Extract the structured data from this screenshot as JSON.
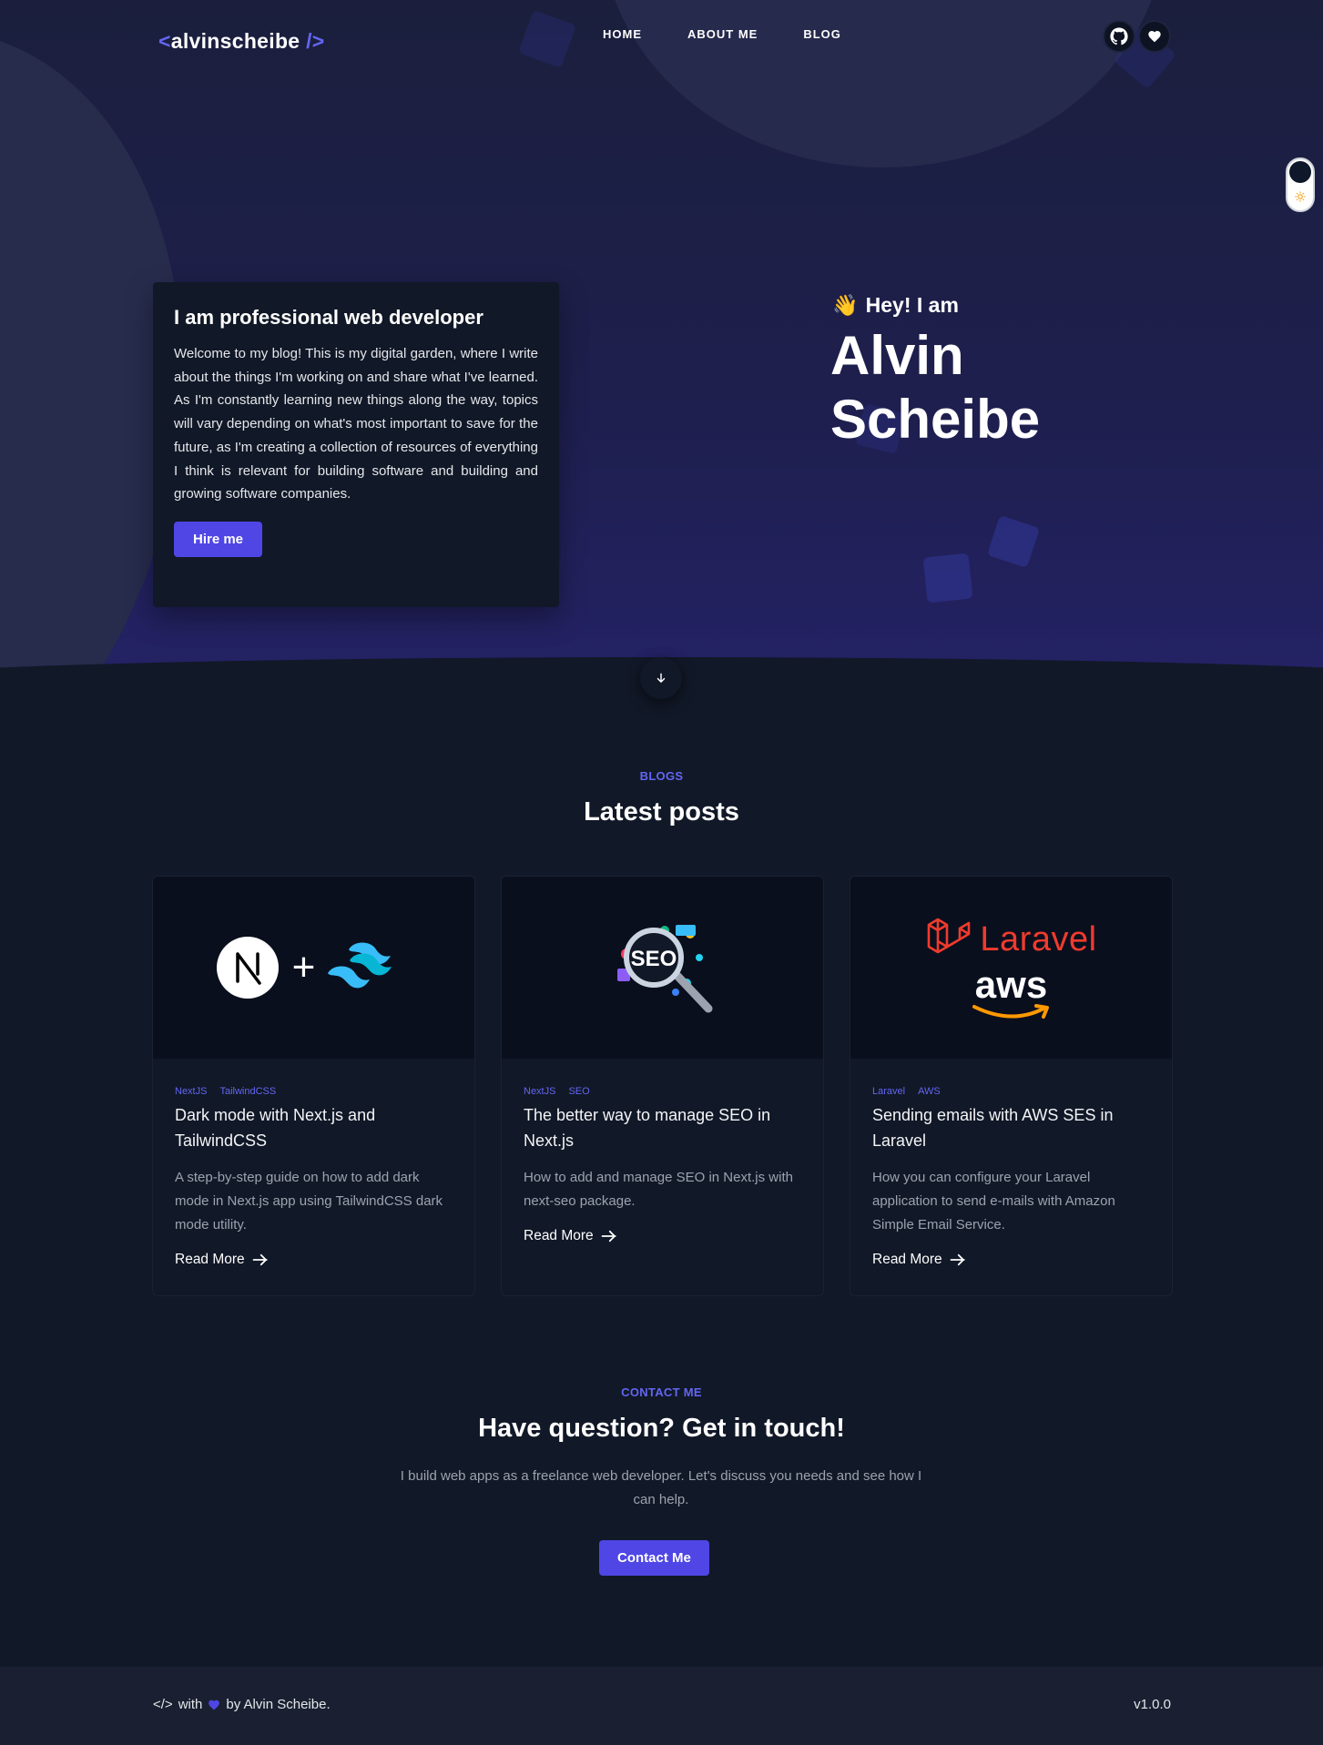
{
  "header": {
    "logo_open": "<",
    "logo_name": "alvinscheibe",
    "logo_close": "/>",
    "nav": [
      {
        "label": "HOME"
      },
      {
        "label": "ABOUT ME"
      },
      {
        "label": "BLOG"
      }
    ],
    "icons": [
      "github-icon",
      "heart-icon"
    ],
    "theme_toggle": {
      "state": "dark"
    }
  },
  "hero": {
    "card_title": "I am professional web developer",
    "card_text": "Welcome to my blog! This is my digital garden, where I write about the things I'm working on and share what I've learned. As I'm constantly learning new things along the way, topics will vary depending on what's most important to save for the future, as I'm creating a collection of resources of everything I think is relevant for building software and building and growing software companies.",
    "hire_label": "Hire me",
    "greeting": "Hey! I am",
    "greeting_emoji": "👋",
    "name_first": "Alvin",
    "name_last": "Scheibe"
  },
  "blogs": {
    "eyebrow": "BLOGS",
    "title": "Latest posts",
    "posts": [
      {
        "tags": [
          "NextJS",
          "TailwindCSS"
        ],
        "title": "Dark mode with Next.js and TailwindCSS",
        "description": "A step-by-step guide on how to add dark mode in Next.js app using TailwindCSS dark mode utility.",
        "read_more": "Read More",
        "thumb": "nextjs-tailwind-logo",
        "thumb_plus": "+"
      },
      {
        "tags": [
          "NextJS",
          "SEO"
        ],
        "title": "The better way to manage SEO in Next.js",
        "description": "How to add and manage SEO in Next.js with next-seo package.",
        "read_more": "Read More",
        "thumb": "seo-magnifier-logo",
        "thumb_text": "SEO"
      },
      {
        "tags": [
          "Laravel",
          "AWS"
        ],
        "title": "Sending emails with AWS SES in Laravel",
        "description": "How you can configure your Laravel application to send e-mails with Amazon Simple Email Service.",
        "read_more": "Read More",
        "thumb": "laravel-aws-logo",
        "thumb_text_1": "Laravel",
        "thumb_text_2": "aws"
      }
    ]
  },
  "contact": {
    "eyebrow": "CONTACT ME",
    "title": "Have question? Get in touch!",
    "text": "I build web apps as a freelance web developer. Let's discuss you needs and see how I can help.",
    "button_label": "Contact Me"
  },
  "footer": {
    "code": "</>",
    "with": "with",
    "by": "by Alvin Scheibe.",
    "version": "v1.0.0"
  },
  "colors": {
    "accent": "#4f46e5",
    "accent_text": "#6366f1",
    "background": "#111827",
    "hero_bg": "#1e1f4e",
    "footer_bg": "#1a2031"
  }
}
